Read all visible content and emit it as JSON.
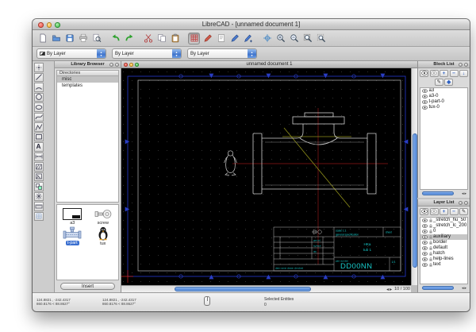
{
  "window": {
    "title": "LibreCAD - [unnamed document 1]"
  },
  "toolbar": {
    "icons": [
      "new-file",
      "open-file",
      "save-file",
      "print",
      "print-preview",
      "undo",
      "redo",
      "cut",
      "copy",
      "paste",
      "draw-grid",
      "pen-attributes",
      "notes",
      "pen-blue",
      "pen-modify",
      "snap-free",
      "zoom-in",
      "zoom-out",
      "zoom-auto",
      "zoom-window"
    ],
    "active_icon": "draw-grid"
  },
  "format_bar": {
    "combos": [
      {
        "value": "By Layer"
      },
      {
        "value": "By Layer"
      },
      {
        "value": "By Layer"
      }
    ]
  },
  "palette": {
    "icons": [
      "point-tool",
      "line-tool",
      "arc-tool",
      "circle-tool",
      "ellipse-tool",
      "spline-tool",
      "polyline-tool",
      "rect-tool",
      "text-tool",
      "dimension-tool",
      "hatch-tool",
      "image-tool",
      "block-tool",
      "explode-tool",
      "measure-tool",
      "snap-grid-tool"
    ]
  },
  "library": {
    "title": "Library Browser",
    "directories_label": "Directories",
    "directories": [
      {
        "name": "misc",
        "selected": true
      },
      {
        "name": "templates",
        "selected": false
      }
    ],
    "items": [
      {
        "label": "a3"
      },
      {
        "label": "screw"
      },
      {
        "label": "t-part",
        "selected": true
      },
      {
        "label": "tux"
      }
    ],
    "insert_label": "Insert"
  },
  "document": {
    "title": "unnamed document 1",
    "grid_status": "10 / 100"
  },
  "block_list": {
    "title": "Block List",
    "toolbar": [
      "show-all-blocks",
      "hide-all-blocks",
      "add-block",
      "remove-block",
      "insert-block",
      "edit-block",
      "save-block"
    ],
    "items": [
      "a3",
      "a3-0",
      "t-part-0",
      "tux-0"
    ]
  },
  "layer_list": {
    "title": "Layer List",
    "toolbar": [
      "show-all-layers",
      "hide-all-layers",
      "add-layer",
      "remove-layer",
      "edit-layer"
    ],
    "items": [
      {
        "name": "_stretch_hu_50"
      },
      {
        "name": "_stretch_lc_200"
      },
      {
        "name": "0"
      },
      {
        "name": "auxiliary",
        "selected": true
      },
      {
        "name": "border"
      },
      {
        "name": "default"
      },
      {
        "name": "hatch"
      },
      {
        "name": "help-lines"
      },
      {
        "name": "text"
      }
    ]
  },
  "title_block": {
    "scale": "scale 1:1",
    "spec": "general specification",
    "sheet": "sheet",
    "c1": "gen.tol.",
    "c2": "surface",
    "c3": "qty",
    "name1": "HKa",
    "name2": "tub 1",
    "number_label": "part number",
    "number": "DD00NN",
    "page": "1/1",
    "footer": "date name drawn checked"
  },
  "status": {
    "abs1": "124.8821 , -242.4317",
    "abs2": "860.8176 < 88.8627°",
    "rel1": "124.8821 , -242.4317",
    "rel2": "860.8176 < 88.8627°",
    "selected_label": "Selected Entities",
    "selected_count": "0"
  },
  "colors": {
    "canvas_bg": "#000000",
    "paper_frame": "#2233bb",
    "drawing_line": "#cfcfcf",
    "centerline": "#8f1616",
    "auxiliary_line": "#8f8f1a",
    "titleblock_text": "#17c9c9",
    "selection": "#3a6fd0"
  }
}
